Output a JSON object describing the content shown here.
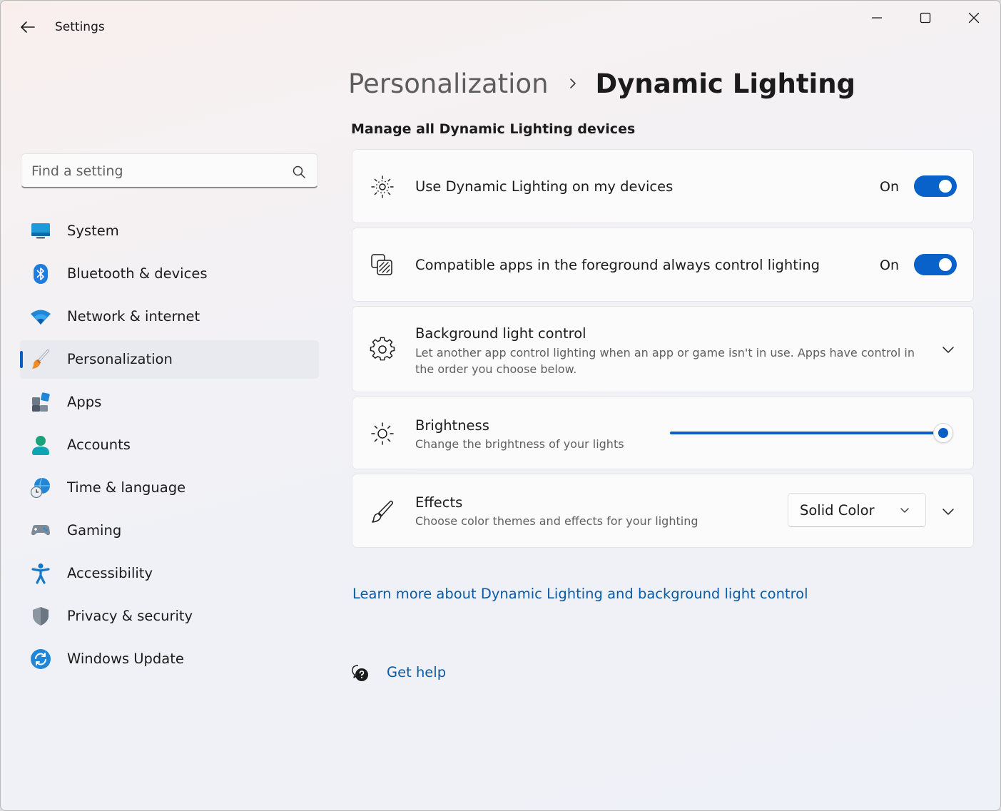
{
  "window": {
    "title": "Settings",
    "back_icon": "arrow-left-icon",
    "controls": [
      "minimize-icon",
      "maximize-icon",
      "close-icon"
    ]
  },
  "search": {
    "placeholder": "Find a setting",
    "value": "",
    "icon": "search-icon"
  },
  "sidebar": {
    "selected_index": 3,
    "items": [
      {
        "label": "System",
        "icon": "monitor-icon"
      },
      {
        "label": "Bluetooth & devices",
        "icon": "bluetooth-icon"
      },
      {
        "label": "Network & internet",
        "icon": "wifi-icon"
      },
      {
        "label": "Personalization",
        "icon": "paintbrush-icon"
      },
      {
        "label": "Apps",
        "icon": "apps-icon"
      },
      {
        "label": "Accounts",
        "icon": "person-icon"
      },
      {
        "label": "Time & language",
        "icon": "globe-clock-icon"
      },
      {
        "label": "Gaming",
        "icon": "gamepad-icon"
      },
      {
        "label": "Accessibility",
        "icon": "accessibility-icon"
      },
      {
        "label": "Privacy & security",
        "icon": "shield-icon"
      },
      {
        "label": "Windows Update",
        "icon": "sync-icon"
      }
    ]
  },
  "breadcrumb": {
    "parent": "Personalization",
    "current": "Dynamic Lighting"
  },
  "main": {
    "section_title": "Manage all Dynamic Lighting devices",
    "use_dynamic_lighting": {
      "title": "Use Dynamic Lighting on my devices",
      "state_label": "On",
      "enabled": true,
      "icon": "dynamic-lighting-icon"
    },
    "compatible_apps": {
      "title": "Compatible apps in the foreground always control lighting",
      "state_label": "On",
      "enabled": true,
      "icon": "layered-squares-icon"
    },
    "background_control": {
      "title": "Background light control",
      "description": "Let another app control lighting when an app or game isn't in use. Apps have control in the order you choose below.",
      "icon": "gear-icon",
      "expander_icon": "chevron-down-icon"
    },
    "brightness": {
      "title": "Brightness",
      "description": "Change the brightness of your lights",
      "value_percent": 100,
      "icon": "sun-icon"
    },
    "effects": {
      "title": "Effects",
      "description": "Choose color themes and effects for your lighting",
      "selected": "Solid Color",
      "icon": "brush-icon",
      "expander_icon": "chevron-down-icon"
    },
    "learn_more": "Learn more about Dynamic Lighting and background light control",
    "get_help": "Get help"
  },
  "colors": {
    "accent": "#0A5FC4",
    "link": "#0A5BA8",
    "selected_nav": "#E9EAF0"
  }
}
